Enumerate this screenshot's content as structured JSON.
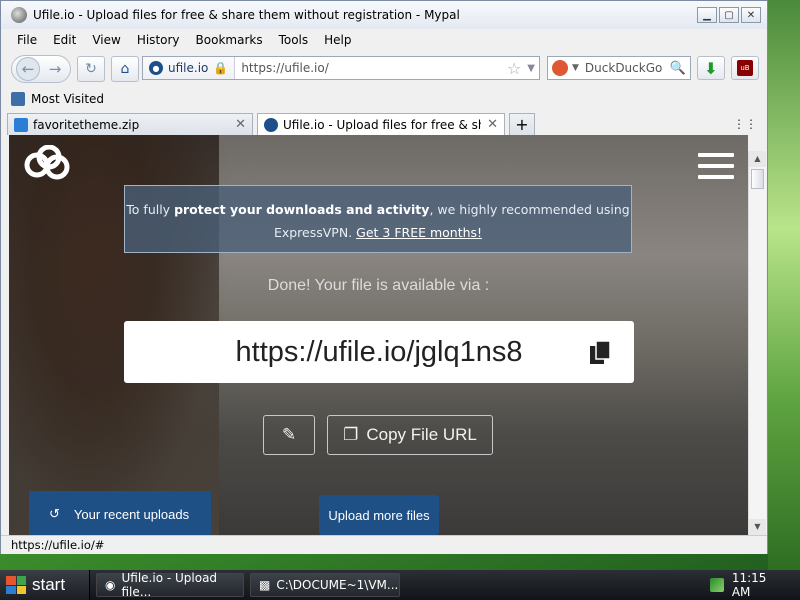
{
  "window": {
    "title": "Ufile.io - Upload files for free & share them without registration - Mypal",
    "controls": {
      "minimize": "▁",
      "maximize": "▢",
      "close": "✕"
    }
  },
  "menu": [
    "File",
    "Edit",
    "View",
    "History",
    "Bookmarks",
    "Tools",
    "Help"
  ],
  "navbar": {
    "site_identity": "ufile.io",
    "url": "https://ufile.io/",
    "search_engine": "DuckDuckGo"
  },
  "bookmarks": {
    "most_visited": "Most Visited"
  },
  "tabs": [
    {
      "label": "favoritetheme.zip",
      "active": false
    },
    {
      "label": "Ufile.io - Upload files for free & share ...",
      "active": true
    }
  ],
  "page": {
    "vpn_notice": {
      "prefix": "To fully ",
      "bold": "protect your downloads and activity",
      "middle": ", we highly recommended using ExpressVPN. ",
      "link": "Get 3 FREE months!"
    },
    "done_message": "Done! Your file is available via :",
    "file_url": "https://ufile.io/jglq1ns8",
    "copy_button": "Copy File URL",
    "recent_uploads": "Your recent uploads",
    "upload_more": "Upload more files"
  },
  "status_bar": "https://ufile.io/#",
  "taskbar": {
    "start": "start",
    "tasks": [
      "Ufile.io - Upload file...",
      "C:\\DOCUME~1\\VM..."
    ],
    "clock": "11:15 AM"
  },
  "colors": {
    "accent_blue": "#1e4f85",
    "vpn_bg": "#4a6078"
  }
}
